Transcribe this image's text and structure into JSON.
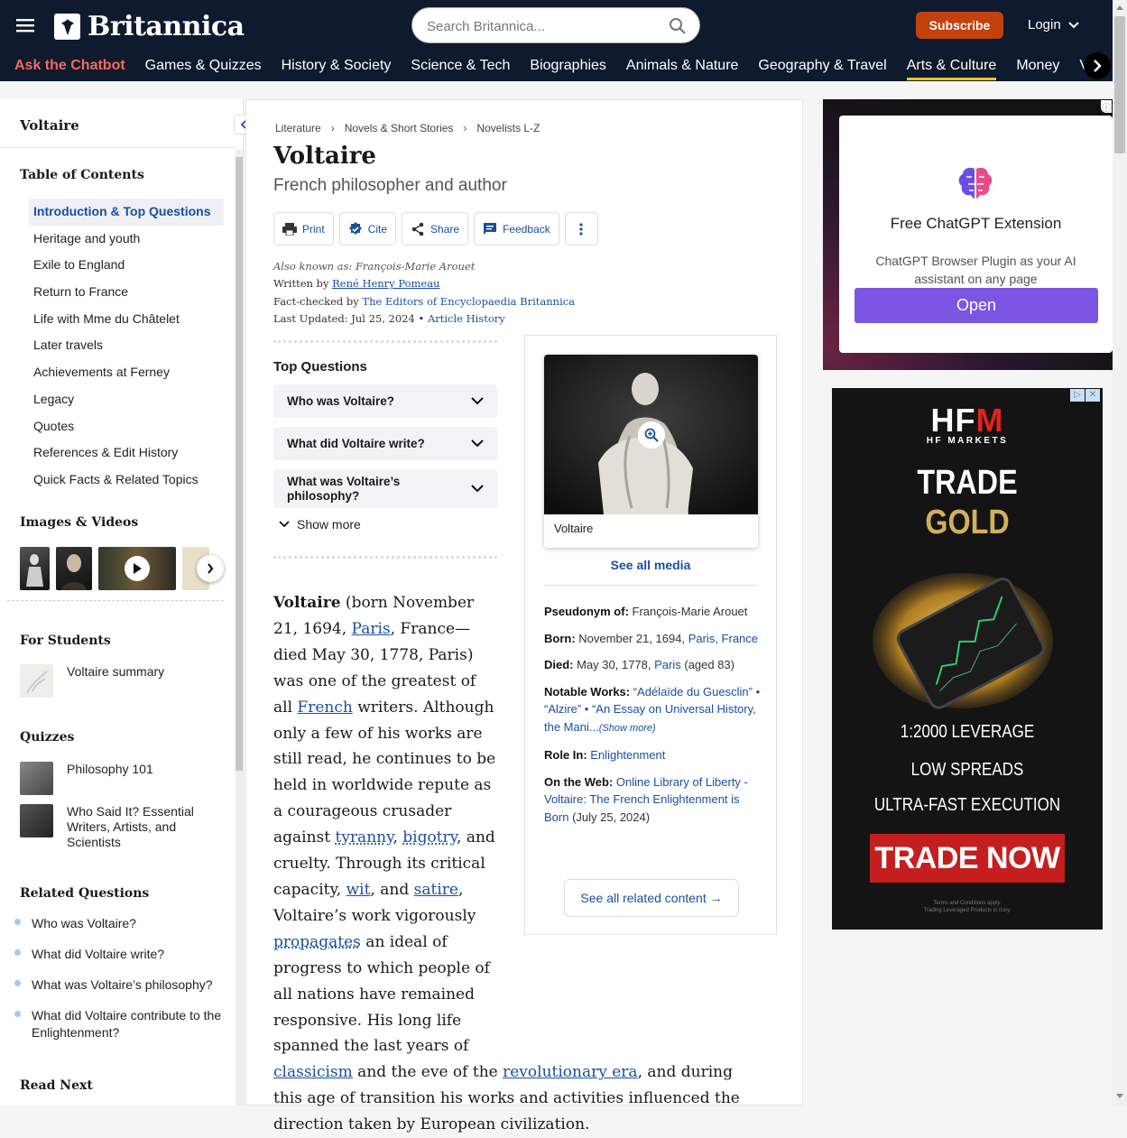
{
  "header": {
    "logo_text": "Britannica",
    "search_placeholder": "Search Britannica...",
    "subscribe_label": "Subscribe",
    "login_label": "Login",
    "nav": [
      "Ask the Chatbot",
      "Games & Quizzes",
      "History & Society",
      "Science & Tech",
      "Biographies",
      "Animals & Nature",
      "Geography & Travel",
      "Arts & Culture",
      "Money",
      "V"
    ],
    "active_nav": "Arts & Culture"
  },
  "sidebar": {
    "title": "Voltaire",
    "toc_heading": "Table of Contents",
    "toc": [
      "Introduction & Top Questions",
      "Heritage and youth",
      "Exile to England",
      "Return to France",
      "Life with Mme du Châtelet",
      "Later travels",
      "Achievements at Ferney",
      "Legacy",
      "Quotes",
      "References & Edit History",
      "Quick Facts & Related Topics"
    ],
    "images_heading": "Images & Videos",
    "students_heading": "For Students",
    "students_item": "Voltaire summary",
    "quizzes_heading": "Quizzes",
    "quizzes": [
      "Philosophy 101",
      "Who Said It? Essential Writers, Artists, and Scientists"
    ],
    "related_heading": "Related Questions",
    "related": [
      "Who was Voltaire?",
      "What did Voltaire write?",
      "What was Voltaire’s philosophy?",
      "What did Voltaire contribute to the Enlightenment?"
    ],
    "read_next_heading": "Read Next"
  },
  "main": {
    "breadcrumb": [
      "Literature",
      "Novels & Short Stories",
      "Novelists L-Z"
    ],
    "title": "Voltaire",
    "subtitle": "French philosopher and author",
    "tools": {
      "print": "Print",
      "cite": "Cite",
      "share": "Share",
      "feedback": "Feedback"
    },
    "meta": {
      "aka": "Also known as: François-Marie Arouet",
      "written_by_label": "Written by",
      "author": "René Henry Pomeau",
      "fact_checked_label": "Fact-checked by",
      "checker": "The Editors of Encyclopaedia Britannica",
      "updated_label": "Last Updated: Jul 25, 2024",
      "bullet": "•",
      "history": "Article History"
    },
    "top_questions_heading": "Top Questions",
    "top_questions": [
      "Who was Voltaire?",
      "What did Voltaire write?",
      "What was Voltaire’s philosophy?"
    ],
    "show_more": "Show more",
    "article": {
      "name": "Voltaire",
      "t1": " (born November 21, 1694, ",
      "paris1": "Paris",
      "t2": ", France—died May 30, 1778, Paris) was one of the greatest of all ",
      "french": "French",
      "t3": " writers. Although only a few of his works are still read, he continues to be held in worldwide repute as a courageous crusader against ",
      "tyranny": "tyranny",
      "c1": ", ",
      "bigotry": "bigotry",
      "t4": ", and cruelty. Through its critical capacity, ",
      "wit": "wit",
      "t5": ", and ",
      "satire": "satire",
      "t6": ", Voltaire’s work vigorously ",
      "propagates": "propagates",
      "t7": " an ideal of progress to which people of all nations have remained responsive. His long life spanned the last years of ",
      "classicism": "classicism",
      "t8": " and the eve of the ",
      "revolutionary": "revolutionary era",
      "t9": ", and during this age of transition his works and activities influenced the direction taken by European civilization."
    }
  },
  "infobox": {
    "caption": "Voltaire",
    "see_all_media": "See all media",
    "pseudonym_label": "Pseudonym of:",
    "pseudonym": " François-Marie Arouet",
    "born_label": "Born:",
    "born": " November 21, 1694, ",
    "born_place": "Paris, France",
    "died_label": "Died:",
    "died": " May 30, 1778, ",
    "died_place": "Paris",
    "died_age": " (aged 83)",
    "works_label": "Notable Works:",
    "works": " “Adélaïde du Guesclin” • “Alzire” • “An Essay on Universal History, the Mani...",
    "works_more": "(Show more)",
    "role_label": "Role In:",
    "role": " Enlightenment",
    "web_label": "On the Web:",
    "web": " Online Library of Liberty - Voltaire: The French Enlightenment is Born",
    "web_date": " (July 25, 2024)",
    "related_button": "See all related content →"
  },
  "ads": {
    "ad1_title": "Free ChatGPT Extension",
    "ad1_desc": "ChatGPT Browser Plugin as your AI assistant on any page",
    "ad1_button": "Open",
    "ad2_logo_a": "HF",
    "ad2_logo_b": "M",
    "ad2_sub": "HF MARKETS",
    "ad2_h1": "TRADE",
    "ad2_h2": "GOLD",
    "ad2_line1": "1:2000 LEVERAGE",
    "ad2_line2": "LOW SPREADS",
    "ad2_line3": "ULTRA-FAST EXECUTION",
    "ad2_cta": "TRADE NOW",
    "ad2_terms1": "Terms and Conditions apply.",
    "ad2_terms2": "Trading Leveraged Products is risky."
  },
  "colors": {
    "header_bg": "#0f1a2e",
    "accent": "#1a4fa0",
    "subscribe": "#c2410c",
    "nav_active_underline": "#f0c419"
  }
}
